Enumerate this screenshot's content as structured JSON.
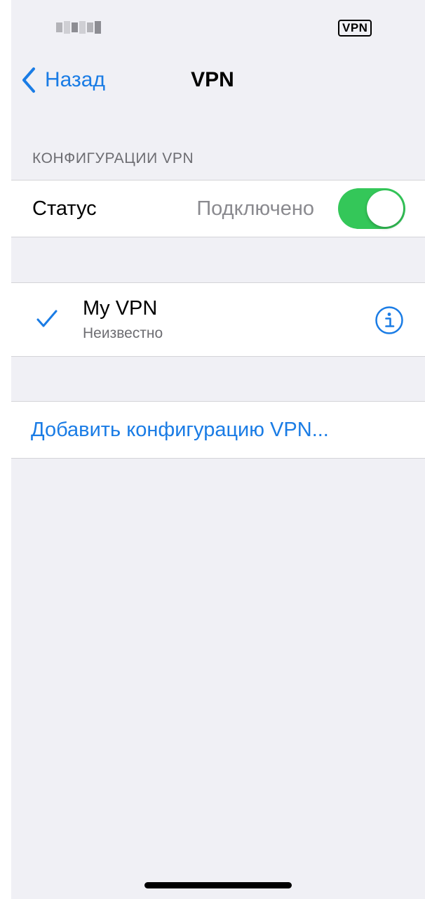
{
  "status_bar": {
    "carrier": "",
    "vpn_badge": "VPN"
  },
  "nav": {
    "back_label": "Назад",
    "title": "VPN"
  },
  "section_header": "КОНФИГУРАЦИИ VPN",
  "status_row": {
    "label": "Статус",
    "value": "Подключено",
    "toggle_on": true
  },
  "vpn_config": {
    "name": "My VPN",
    "subtitle": "Неизвестно",
    "selected": true
  },
  "add_config_label": "Добавить конфигурацию VPN...",
  "colors": {
    "accent": "#1a7ce5",
    "toggle_on": "#34c759",
    "background": "#f0f0f5"
  },
  "icons": [
    "chevron-left-icon",
    "checkmark-icon",
    "info-icon"
  ]
}
